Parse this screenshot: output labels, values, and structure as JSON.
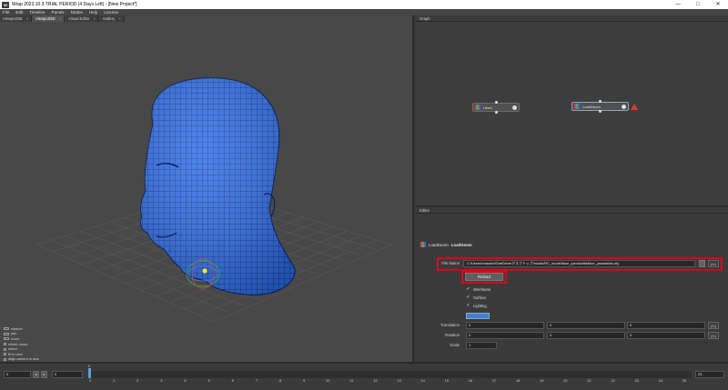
{
  "window": {
    "app_icon": "W",
    "title": "Wrap 2023.10.3  TRIAL PERIOD (4 Days Left) - [New Project*]",
    "controls": [
      "—",
      "□",
      "✕"
    ]
  },
  "menu": [
    "File",
    "Edit",
    "Timeline",
    "Panels",
    "Nodes",
    "Help",
    "License"
  ],
  "viewport": {
    "tabs": [
      {
        "label": "Viewport3D",
        "active": false
      },
      {
        "label": "Viewport3D",
        "active": true
      },
      {
        "label": "Visual Editor",
        "active": false
      },
      {
        "label": "Gallery",
        "active": false
      }
    ],
    "legend": [
      "rotation",
      "pan",
      "zoom",
      "wheel: zoom",
      "select",
      "fit to view",
      "align camera to axis"
    ]
  },
  "graph": {
    "title": "Graph",
    "nodes": [
      {
        "label": "Head"
      },
      {
        "label": "LoadGeom"
      }
    ],
    "warning_color": "#e03a2c"
  },
  "editor": {
    "title": "Editor",
    "node_type": "LoadGeom",
    "node_name": "LoadGeom",
    "file_name_label": "File Name",
    "file_name_value": "C:/Users/masashi/OneDrive/デスクトップ/model/RC_model/face_yamashita/face_yamashita.obj",
    "fx": "{fx}",
    "reload_label": "Reload",
    "checkboxes": [
      {
        "label": "Wireframe",
        "checked": true
      },
      {
        "label": "Surface",
        "checked": true
      },
      {
        "label": "Lighting",
        "checked": true
      }
    ],
    "color": "#3f7fd6",
    "translation_label": "Translation",
    "translation": [
      "0",
      "0",
      "0"
    ],
    "rotation_label": "Rotation",
    "rotation": [
      "0",
      "0",
      "0"
    ],
    "scale_label": "Scale",
    "scale": "1",
    "highlight_color": "#e0001b"
  },
  "timeline": {
    "start": "0",
    "current": "0",
    "end": "25",
    "cursor_label": "0",
    "ticks": [
      "0",
      "1",
      "2",
      "3",
      "4",
      "5",
      "6",
      "7",
      "8",
      "9",
      "10",
      "11",
      "12",
      "13",
      "14",
      "15",
      "16",
      "17",
      "18",
      "19",
      "20",
      "21",
      "22",
      "23",
      "24",
      "25"
    ]
  }
}
